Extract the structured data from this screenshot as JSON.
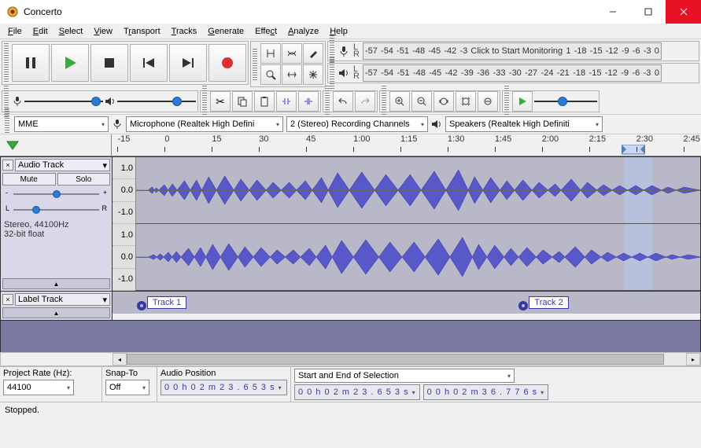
{
  "window": {
    "title": "Concerto"
  },
  "menu": [
    "File",
    "Edit",
    "Select",
    "View",
    "Transport",
    "Tracks",
    "Generate",
    "Effect",
    "Analyze",
    "Help"
  ],
  "meters": {
    "rec_ticks": [
      "-57",
      "-54",
      "-51",
      "-48",
      "-45",
      "-42",
      "-3"
    ],
    "rec_text": "Click to Start Monitoring",
    "rec_ticks2": [
      "1",
      "-18",
      "-15",
      "-12",
      "-9",
      "-6",
      "-3",
      "0"
    ],
    "play_ticks": [
      "-57",
      "-54",
      "-51",
      "-48",
      "-45",
      "-42",
      "-39",
      "-36",
      "-33",
      "-30",
      "-27",
      "-24",
      "-21",
      "-18",
      "-15",
      "-12",
      "-9",
      "-6",
      "-3",
      "0"
    ]
  },
  "devices": {
    "host": "MME",
    "input": "Microphone (Realtek High Defini",
    "channels": "2 (Stereo) Recording Channels",
    "output": "Speakers (Realtek High Definiti"
  },
  "ruler": {
    "ticks": [
      "-15",
      "0",
      "15",
      "30",
      "45",
      "1:00",
      "1:15",
      "1:30",
      "1:45",
      "2:00",
      "2:15",
      "2:30",
      "2:45"
    ]
  },
  "tracks": {
    "audio": {
      "name": "Audio Track",
      "mute": "Mute",
      "solo": "Solo",
      "info1": "Stereo, 44100Hz",
      "info2": "32-bit float",
      "amp": [
        "1.0",
        "0.0",
        "-1.0"
      ]
    },
    "label": {
      "name": "Label Track",
      "labels": [
        {
          "text": "Track 1",
          "pos_pct": 4
        },
        {
          "text": "Track 2",
          "pos_pct": 69
        }
      ]
    }
  },
  "selection": {
    "rate_label": "Project Rate (Hz):",
    "rate": "44100",
    "snap_label": "Snap-To",
    "snap": "Off",
    "audio_pos_label": "Audio Position",
    "audio_pos": "0 0 h 0 2 m 2 3 . 6 5 3 s",
    "range_label": "Start and End of Selection",
    "start": "0 0 h 0 2 m 2 3 . 6 5 3 s",
    "end": "0 0 h 0 2 m 3 6 . 7 7 6 s"
  },
  "status": "Stopped."
}
